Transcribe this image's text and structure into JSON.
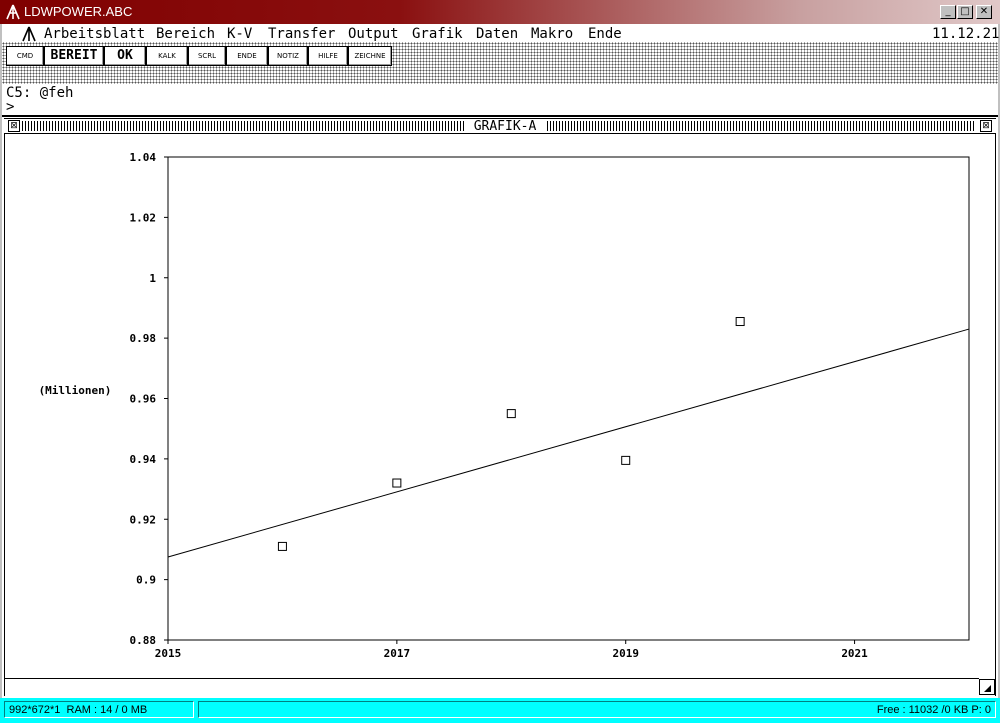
{
  "window": {
    "title": "LDWPOWER.ABC",
    "buttons": {
      "minimize": "_",
      "maximize": "□",
      "close": "✕"
    }
  },
  "menu": {
    "items": [
      "Arbeitsblatt",
      "Bereich",
      "K-V",
      "Transfer",
      "Output",
      "Grafik",
      "Daten",
      "Makro",
      "Ende"
    ],
    "date": "11.12.21"
  },
  "toolbar": {
    "buttons": [
      "CMD",
      "BEREIT",
      "OK",
      "KALK",
      "SCRL",
      "ENDE",
      "NOTIZ",
      "HILFE",
      "ZEICHNE"
    ]
  },
  "formula": {
    "cell": "C5: @feh",
    "prompt": ">"
  },
  "graph_window": {
    "title": "GRAFIK-A"
  },
  "chart_data": {
    "type": "scatter",
    "ylabel": "(Millionen)",
    "xlim": [
      2015,
      2022
    ],
    "ylim": [
      0.88,
      1.04
    ],
    "x_ticks": [
      2015,
      2017,
      2019,
      2021
    ],
    "y_ticks": [
      "0.88",
      "0.9",
      "0.92",
      "0.94",
      "0.96",
      "0.98",
      "1",
      "1.02",
      "1.04"
    ],
    "series": [
      {
        "points": [
          {
            "x": 2016,
            "y": 0.911
          },
          {
            "x": 2017,
            "y": 0.932
          },
          {
            "x": 2018,
            "y": 0.955
          },
          {
            "x": 2019,
            "y": 0.9395
          },
          {
            "x": 2020,
            "y": 0.9855
          }
        ]
      }
    ],
    "trendline": {
      "x": [
        2015,
        2022
      ],
      "y": [
        0.9075,
        0.983
      ]
    },
    "grid": false
  },
  "statusbar": {
    "screen": "992*672*1",
    "ram": "RAM : 14 / 0 MB",
    "free": "Free : 11032 /0 KB  P: 0"
  }
}
